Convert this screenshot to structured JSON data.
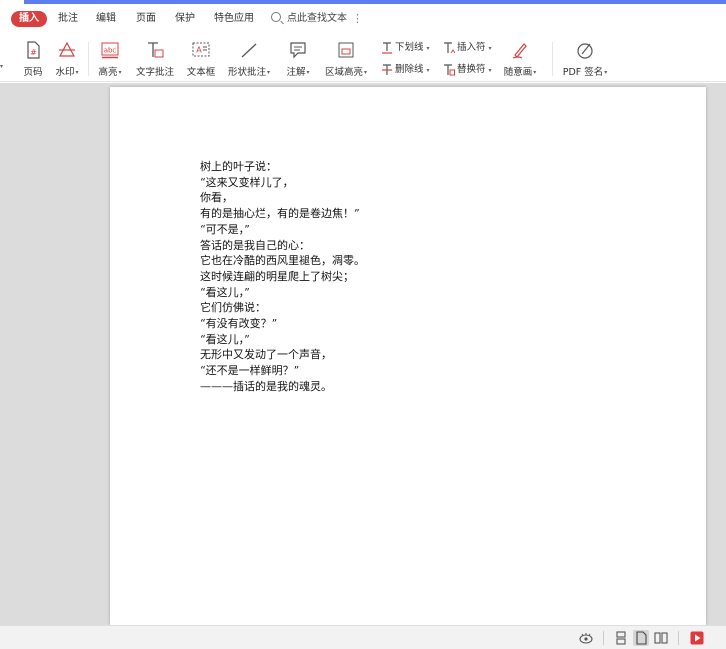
{
  "menu": {
    "items": [
      {
        "id": "insert",
        "label": "插入",
        "active": true
      },
      {
        "id": "comment",
        "label": "批注"
      },
      {
        "id": "edit",
        "label": "编辑"
      },
      {
        "id": "page",
        "label": "页面"
      },
      {
        "id": "protect",
        "label": "保护"
      },
      {
        "id": "features",
        "label": "特色应用"
      }
    ],
    "search_label": "点此查找文本",
    "accent": "#d9403f"
  },
  "toolbar": {
    "page_number": "页码",
    "watermark": "水印",
    "highlight": "高亮",
    "text_comment": "文字批注",
    "text_box": "文本框",
    "shape_comment": "形状批注",
    "annotation": "注解",
    "area_highlight": "区域高亮",
    "underline": "下划线",
    "strikethrough": "删除线",
    "insert_symbol": "插入符",
    "replace_symbol": "替换符",
    "freehand": "随意画",
    "pdf_sign": "PDF 签名"
  },
  "document": {
    "lines": [
      "树上的叶子说：",
      "“这来又变样儿了，",
      "你看，",
      "有的是抽心烂，有的是卷边焦！”",
      "“可不是，”",
      "答话的是我自己的心：",
      "它也在冷酷的西风里褪色，凋零。",
      "这时候连翩的明星爬上了树尖；",
      "“看这儿，”",
      "它们仿佛说：",
      "“有没有改变？”",
      "“看这儿，”",
      "无形中又发动了一个声音，",
      "“还不是一样鲜明？”",
      "———插话的是我的魂灵。"
    ]
  },
  "status": {
    "view_icons": [
      "eye-icon",
      "continuous-view-icon",
      "single-page-icon",
      "two-page-icon",
      "play-icon"
    ]
  }
}
